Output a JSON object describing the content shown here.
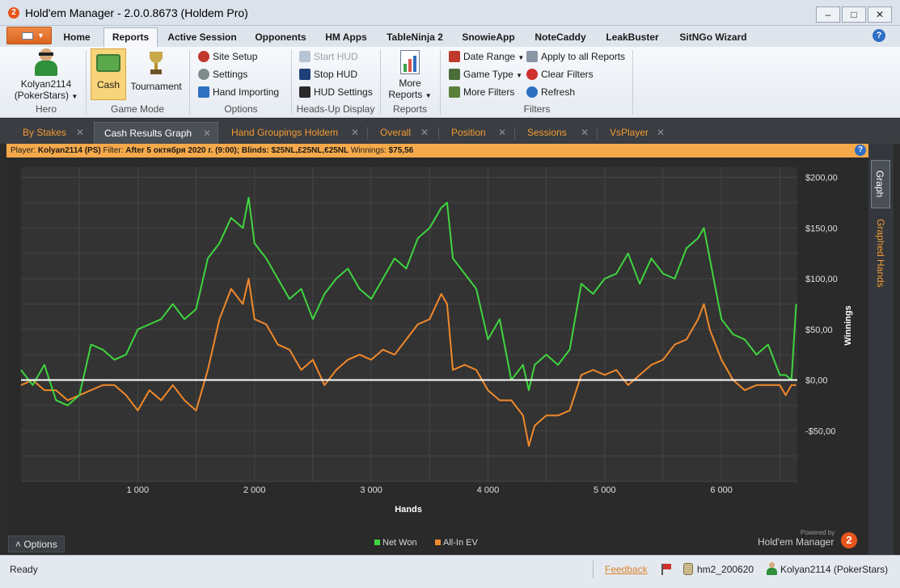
{
  "window": {
    "title": "Hold'em Manager - 2.0.0.8673 (Holdem Pro)",
    "app_icon_text": "2",
    "min": "–",
    "max": "□",
    "close": "✕"
  },
  "ribbon_tabs": [
    "Home",
    "Reports",
    "Active Session",
    "Opponents",
    "HM Apps",
    "TableNinja 2",
    "SnowieApp",
    "NoteCaddy",
    "LeakBuster",
    "SitNGo Wizard"
  ],
  "active_ribbon_tab": "Reports",
  "ribbon": {
    "hero": {
      "name": "Kolyan2114",
      "site": "(PokerStars)",
      "label": "Hero"
    },
    "game_mode": {
      "cash": "Cash",
      "tournament": "Tournament",
      "label": "Game Mode"
    },
    "options": {
      "site_setup": "Site Setup",
      "settings": "Settings",
      "hand_importing": "Hand Importing",
      "label": "Options"
    },
    "hud": {
      "start": "Start HUD",
      "stop": "Stop HUD",
      "settings": "HUD Settings",
      "label": "Heads-Up Display"
    },
    "reports": {
      "more": "More",
      "reports": "Reports",
      "label": "Reports"
    },
    "filters": {
      "date_range": "Date Range",
      "game_type": "Game Type",
      "more_filters": "More Filters",
      "apply_all": "Apply to all Reports",
      "clear": "Clear Filters",
      "refresh": "Refresh",
      "label": "Filters"
    }
  },
  "doc_tabs": [
    "By Stakes",
    "Cash Results Graph",
    "Hand Groupings Holdem",
    "Overall",
    "Position",
    "Sessions",
    "VsPlayer"
  ],
  "active_doc_tab": "Cash Results Graph",
  "info_bar": {
    "player_label": "Player:",
    "player": "Kolyan2114 (PS)",
    "filter_label": "Filter:",
    "filter": "After 5 октября 2020 г. (9:00); Blinds: $25NL,£25NL,€25NL",
    "winnings_label": "Winnings:",
    "winnings": "$75,56"
  },
  "vertical_tabs": {
    "graph": "Graph",
    "graphed_hands": "Graphed Hands"
  },
  "options_button": "˄  Options",
  "brand": {
    "powered": "Powered by",
    "name": "Hold'em Manager",
    "icon": "2"
  },
  "status": {
    "text": "Ready",
    "feedback": "Feedback",
    "db": "hm2_200620",
    "player": "Kolyan2114 (PokerStars)"
  },
  "chart_data": {
    "type": "line",
    "xlabel": "Hands",
    "ylabel": "Winnings",
    "xlim": [
      0,
      6650
    ],
    "ylim": [
      -100,
      210
    ],
    "x_ticks": [
      1000,
      2000,
      3000,
      4000,
      5000,
      6000
    ],
    "x_tick_labels": [
      "1 000",
      "2 000",
      "3 000",
      "4 000",
      "5 000",
      "6 000"
    ],
    "y_ticks": [
      200,
      150,
      100,
      50,
      0,
      -50
    ],
    "y_tick_labels": [
      "$200,00",
      "$150,00",
      "$100,00",
      "$50,00",
      "$0,00",
      "-$50,00"
    ],
    "legend_position": "bottom-center",
    "grid": true,
    "series": [
      {
        "name": "Net Won",
        "color": "#3fd53f",
        "x": [
          0,
          100,
          200,
          300,
          400,
          500,
          600,
          700,
          800,
          900,
          1000,
          1100,
          1200,
          1300,
          1400,
          1500,
          1600,
          1700,
          1800,
          1900,
          1950,
          2000,
          2100,
          2200,
          2300,
          2400,
          2500,
          2600,
          2700,
          2800,
          2900,
          3000,
          3100,
          3200,
          3300,
          3400,
          3500,
          3600,
          3650,
          3700,
          3800,
          3900,
          4000,
          4100,
          4200,
          4300,
          4350,
          4400,
          4500,
          4600,
          4700,
          4800,
          4900,
          5000,
          5100,
          5200,
          5300,
          5400,
          5500,
          5600,
          5700,
          5800,
          5850,
          5900,
          6000,
          6100,
          6200,
          6300,
          6400,
          6500,
          6550,
          6600,
          6640
        ],
        "values": [
          10,
          -5,
          15,
          -20,
          -25,
          -15,
          35,
          30,
          20,
          25,
          50,
          55,
          60,
          75,
          60,
          70,
          120,
          135,
          160,
          150,
          180,
          135,
          120,
          100,
          80,
          90,
          60,
          85,
          100,
          110,
          90,
          80,
          100,
          120,
          110,
          140,
          150,
          170,
          175,
          120,
          105,
          90,
          40,
          60,
          0,
          15,
          -10,
          15,
          25,
          15,
          30,
          95,
          85,
          100,
          105,
          125,
          95,
          120,
          105,
          100,
          130,
          140,
          150,
          120,
          60,
          45,
          40,
          25,
          35,
          5,
          5,
          0,
          75
        ]
      },
      {
        "name": "All-In EV",
        "color": "#f0892b",
        "x": [
          0,
          100,
          200,
          300,
          400,
          500,
          600,
          700,
          800,
          900,
          1000,
          1100,
          1200,
          1300,
          1400,
          1500,
          1600,
          1700,
          1800,
          1900,
          1950,
          2000,
          2100,
          2200,
          2300,
          2400,
          2500,
          2600,
          2700,
          2800,
          2900,
          3000,
          3100,
          3200,
          3300,
          3400,
          3500,
          3600,
          3650,
          3700,
          3800,
          3900,
          4000,
          4100,
          4200,
          4300,
          4350,
          4400,
          4500,
          4600,
          4700,
          4800,
          4900,
          5000,
          5100,
          5200,
          5300,
          5400,
          5500,
          5600,
          5700,
          5800,
          5850,
          5900,
          6000,
          6100,
          6200,
          6300,
          6400,
          6500,
          6550,
          6600,
          6640
        ],
        "values": [
          -5,
          0,
          -10,
          -10,
          -20,
          -15,
          -10,
          -5,
          -5,
          -15,
          -30,
          -10,
          -20,
          -5,
          -20,
          -30,
          10,
          60,
          90,
          75,
          100,
          60,
          55,
          35,
          30,
          10,
          20,
          -5,
          10,
          20,
          25,
          20,
          30,
          25,
          40,
          55,
          60,
          85,
          75,
          10,
          15,
          10,
          -10,
          -20,
          -20,
          -35,
          -65,
          -45,
          -35,
          -35,
          -30,
          5,
          10,
          5,
          10,
          -5,
          5,
          15,
          20,
          35,
          40,
          60,
          75,
          50,
          20,
          0,
          -10,
          -5,
          -5,
          -5,
          -15,
          -5,
          -5
        ]
      }
    ]
  }
}
